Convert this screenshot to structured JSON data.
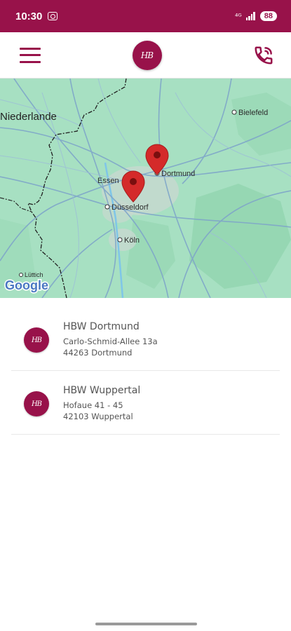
{
  "status_bar": {
    "time": "10:30",
    "network_label": "⁴ᴳ",
    "battery": "88"
  },
  "header": {
    "logo_text": "HB",
    "menu_icon": "hamburger-menu-icon",
    "phone_icon": "phone-call-icon"
  },
  "map": {
    "labels": {
      "niederlande": "Niederlande",
      "bielefeld": "Bielefeld",
      "dortmund": "Dortmund",
      "essen": "Essen",
      "duesseldorf": "Düsseldorf",
      "koeln": "Köln",
      "luettich": "Lüttich"
    },
    "attribution": "Google",
    "marker_color": "#d42a2a"
  },
  "locations": [
    {
      "logo": "HB",
      "name": "HBW Dortmund",
      "street": "Carlo-Schmid-Allee 13a",
      "city": "44263 Dortmund"
    },
    {
      "logo": "HB",
      "name": "HBW Wuppertal",
      "street": "Hofaue 41 - 45",
      "city": "42103 Wuppertal"
    }
  ],
  "colors": {
    "brand": "#98124a",
    "map_bg": "#a7e0c2"
  }
}
